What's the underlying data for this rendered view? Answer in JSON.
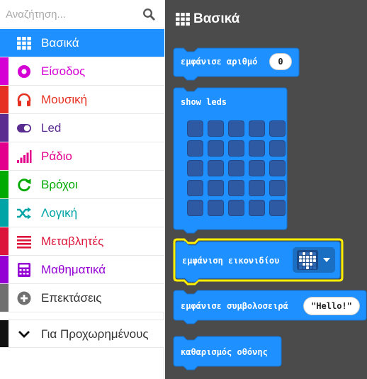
{
  "search": {
    "placeholder": "Αναζήτηση..."
  },
  "toolbox": {
    "categories": [
      {
        "label": "Βασικά",
        "icon": "grid-icon",
        "color": "#1e90ff",
        "selected": true
      },
      {
        "label": "Είσοδος",
        "icon": "input-icon",
        "color": "#d400d4"
      },
      {
        "label": "Μουσική",
        "icon": "headphones-icon",
        "color": "#e63022"
      },
      {
        "label": "Led",
        "icon": "toggle-icon",
        "color": "#5c2d91"
      },
      {
        "label": "Ράδιο",
        "icon": "signal-icon",
        "color": "#e3008c"
      },
      {
        "label": "Βρόχοι",
        "icon": "refresh-icon",
        "color": "#00aa00"
      },
      {
        "label": "Λογική",
        "icon": "shuffle-icon",
        "color": "#00a4a6"
      },
      {
        "label": "Μεταβλητές",
        "icon": "list-icon",
        "color": "#dc143c"
      },
      {
        "label": "Μαθηματικά",
        "icon": "calculator-icon",
        "color": "#9400d3"
      },
      {
        "label": "Επεκτάσεις",
        "icon": "plus-circle-icon",
        "color": "#707070"
      },
      {
        "label": "Για Προχωρημένους",
        "icon": "chevron-down-icon",
        "color": "#111111"
      }
    ]
  },
  "flyout": {
    "title": "Βασικά",
    "block_color": "#1e90ff",
    "highlight_color": "#ffef00",
    "blocks": {
      "show_number": {
        "label": "εμφάνισε αριθμό",
        "value": "0"
      },
      "show_leds": {
        "label": "show leds"
      },
      "show_icon": {
        "label": "εμφάνιση εικονιδίου"
      },
      "show_string": {
        "label": "εμφάνισε συμβολοσειρά",
        "value": "\"Hello!\""
      },
      "clear_screen": {
        "label": "καθαρισμός οθόνης"
      }
    }
  }
}
